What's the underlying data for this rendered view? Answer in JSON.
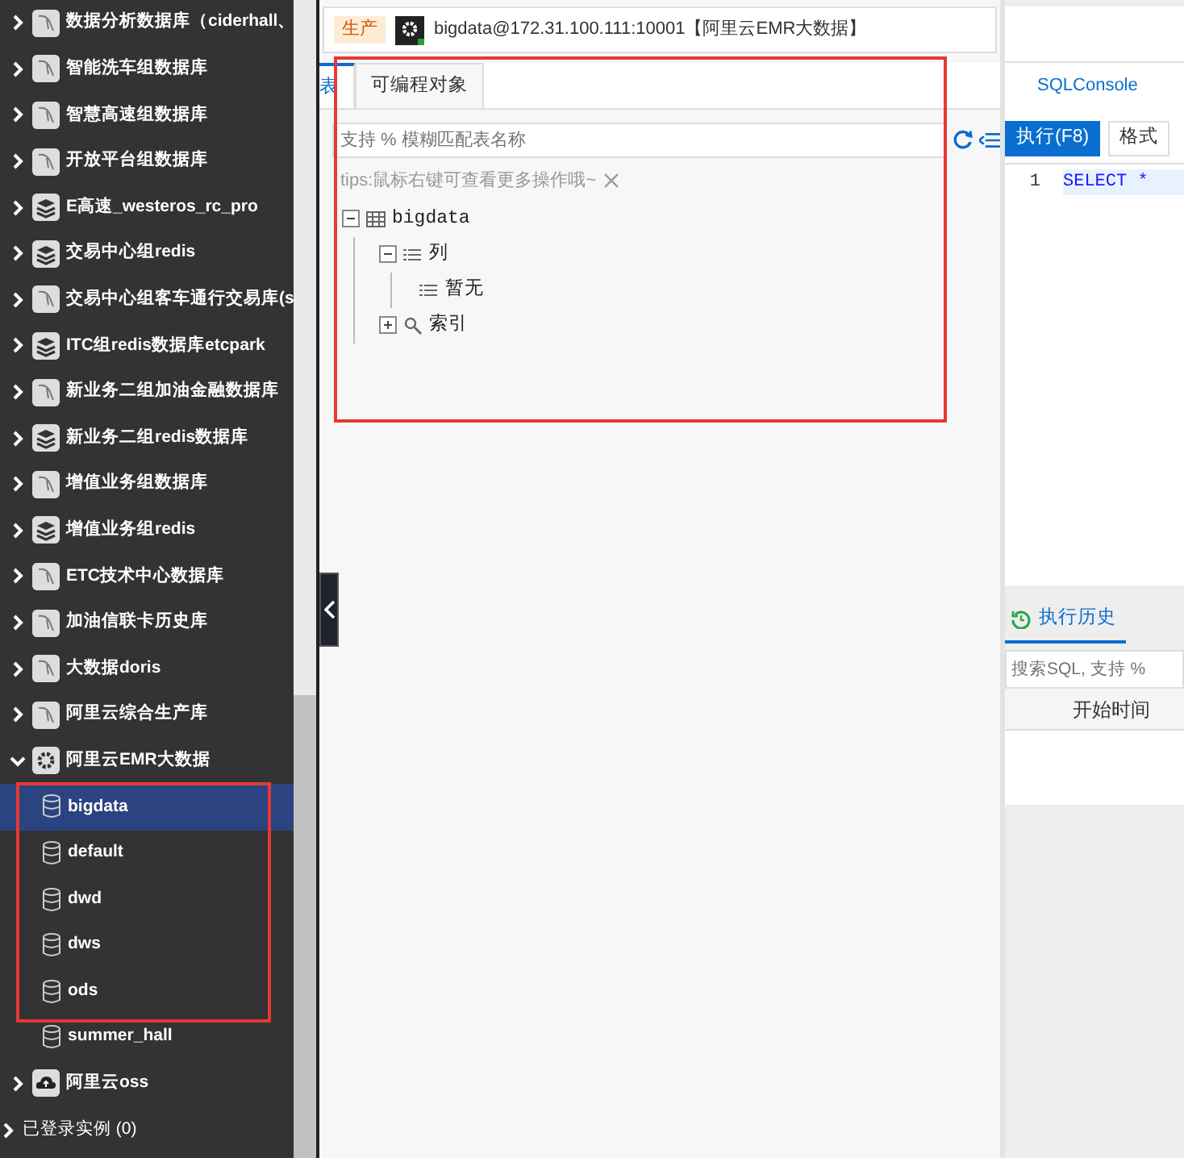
{
  "sidebar": {
    "items": [
      {
        "label": "数据分析数据库（ciderhall、",
        "kind": "mysql",
        "expanded": false
      },
      {
        "label": "智能洗车组数据库",
        "kind": "mysql",
        "expanded": false
      },
      {
        "label": "智慧高速组数据库",
        "kind": "mysql",
        "expanded": false
      },
      {
        "label": "开放平台组数据库",
        "kind": "mysql",
        "expanded": false
      },
      {
        "label": "E高速_westeros_rc_pro",
        "kind": "redis",
        "expanded": false
      },
      {
        "label": "交易中心组redis",
        "kind": "redis",
        "expanded": false
      },
      {
        "label": "交易中心组客车通行交易库(s",
        "kind": "mysql",
        "expanded": false
      },
      {
        "label": "ITC组redis数据库etcpark",
        "kind": "redis",
        "expanded": false
      },
      {
        "label": "新业务二组加油金融数据库",
        "kind": "mysql",
        "expanded": false
      },
      {
        "label": "新业务二组redis数据库",
        "kind": "redis",
        "expanded": false
      },
      {
        "label": "增值业务组数据库",
        "kind": "mysql",
        "expanded": false
      },
      {
        "label": "增值业务组redis",
        "kind": "redis",
        "expanded": false
      },
      {
        "label": "ETC技术中心数据库",
        "kind": "mysql",
        "expanded": false
      },
      {
        "label": "加油信联卡历史库",
        "kind": "mysql",
        "expanded": false
      },
      {
        "label": "大数据doris",
        "kind": "mysql",
        "expanded": false
      },
      {
        "label": "阿里云综合生产库",
        "kind": "mysql",
        "expanded": false
      },
      {
        "label": "阿里云EMR大数据",
        "kind": "emr",
        "expanded": true,
        "highlighted": true,
        "children": [
          {
            "label": "bigdata",
            "selected": true
          },
          {
            "label": "default",
            "selected": false
          },
          {
            "label": "dwd",
            "selected": false
          },
          {
            "label": "dws",
            "selected": false
          },
          {
            "label": "ods",
            "selected": false
          },
          {
            "label": "summer_hall",
            "selected": false
          }
        ]
      },
      {
        "label": "阿里云oss",
        "kind": "cloud",
        "expanded": false
      }
    ],
    "footer": {
      "label": "已登录实例 (0)",
      "expanded": false
    }
  },
  "object_panel": {
    "highlighted": true,
    "connection": {
      "env_tag": "生产",
      "title": "bigdata@172.31.100.111:10001【阿里云EMR大数据】"
    },
    "tabs": [
      {
        "label": "表",
        "selected": true
      },
      {
        "label": "可编程对象",
        "selected": false
      }
    ],
    "search": {
      "placeholder": "支持 % 模糊匹配表名称"
    },
    "tips": "tips:鼠标右键可查看更多操作哦~",
    "tree": [
      {
        "label": "bigdata",
        "kind": "table",
        "expanded": true,
        "children": [
          {
            "label": "列",
            "kind": "columns",
            "expanded": true,
            "children": [
              {
                "label": "暂无",
                "kind": "columns"
              }
            ]
          },
          {
            "label": "索引",
            "kind": "index",
            "expanded": false
          }
        ]
      }
    ]
  },
  "console": {
    "tab": "SQLConsole",
    "buttons": [
      {
        "label": "执行(F8)",
        "kind": "primary"
      },
      {
        "label": "格式",
        "kind": "default"
      }
    ],
    "editor": [
      {
        "number": "1",
        "code": "SELECT *"
      }
    ],
    "history": {
      "tab": "执行历史",
      "search": {
        "placeholder": "搜索SQL, 支持 %"
      },
      "columns": [
        "开始时间"
      ]
    }
  }
}
